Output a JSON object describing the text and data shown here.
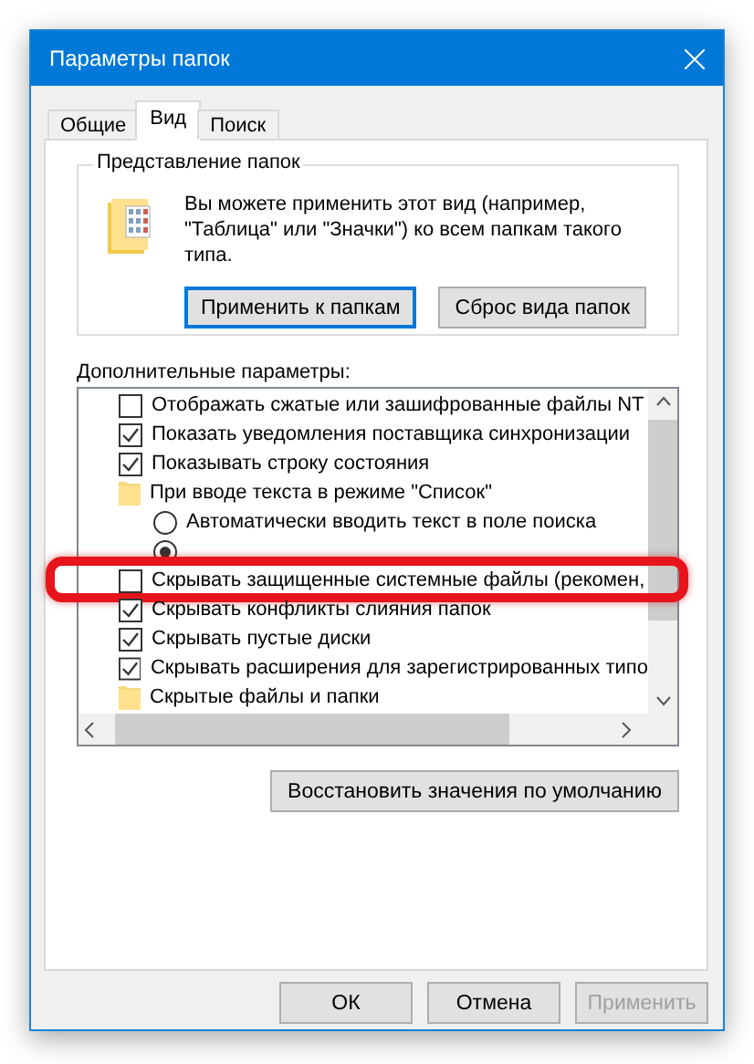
{
  "window": {
    "title": "Параметры папок"
  },
  "tabs": [
    {
      "label": "Общие",
      "selected": false
    },
    {
      "label": "Вид",
      "selected": true
    },
    {
      "label": "Поиск",
      "selected": false
    }
  ],
  "folder_views": {
    "title": "Представление папок",
    "description": "Вы можете применить этот вид (например, \"Таблица\" или \"Значки\") ко всем папкам такого типа.",
    "buttons": [
      {
        "label": "Применить к папкам",
        "focused": true
      },
      {
        "label": "Сброс вида папок",
        "focused": false
      }
    ]
  },
  "advanced": {
    "title": "Дополнительные параметры:",
    "items": [
      {
        "kind": "checkbox",
        "label": "Отображать сжатые или зашифрованные файлы NT",
        "checked": false,
        "highlighted": false
      },
      {
        "kind": "checkbox",
        "label": "Показать уведомления поставщика синхронизации",
        "checked": true,
        "highlighted": false
      },
      {
        "kind": "checkbox",
        "label": "Показывать строку состояния",
        "checked": true,
        "highlighted": false
      },
      {
        "kind": "folder",
        "label": "При вводе текста в режиме \"Список\"",
        "highlighted": false,
        "children": [
          {
            "kind": "radio",
            "label": "Автоматически вводить текст в поле поиска",
            "selected": false
          },
          {
            "kind": "radio",
            "selected": true
          }
        ]
      },
      {
        "kind": "checkbox",
        "label": "Скрывать защищенные системные файлы (рекомен,",
        "checked": false,
        "highlighted": true
      },
      {
        "kind": "checkbox",
        "label": "Скрывать конфликты слияния папок",
        "checked": true,
        "highlighted": false
      },
      {
        "kind": "checkbox",
        "label": "Скрывать пустые диски",
        "checked": true,
        "highlighted": false
      },
      {
        "kind": "checkbox",
        "label": "Скрывать расширения для зарегистрированных типо",
        "checked": true,
        "highlighted": false
      },
      {
        "kind": "folder",
        "label": "Скрытые файлы и папки",
        "highlighted": false
      }
    ]
  },
  "restore_button": {
    "label": "Восстановить значения по умолчанию"
  },
  "buttons": [
    {
      "label": "ОК",
      "disabled": false
    },
    {
      "label": "Отмена",
      "disabled": false
    },
    {
      "label": "Применить",
      "disabled": true
    }
  ]
}
